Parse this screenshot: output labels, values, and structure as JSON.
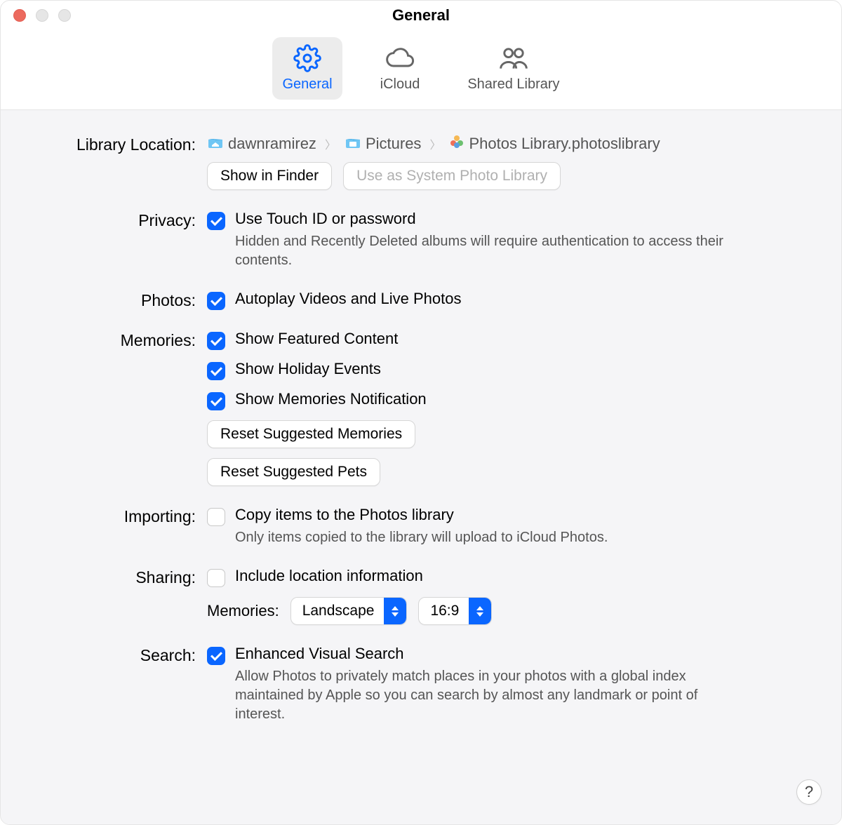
{
  "window": {
    "title": "General"
  },
  "toolbar": {
    "tabs": [
      {
        "label": "General"
      },
      {
        "label": "iCloud"
      },
      {
        "label": "Shared Library"
      }
    ]
  },
  "library": {
    "label": "Library Location:",
    "path": {
      "home": "dawnramirez",
      "folder": "Pictures",
      "file": "Photos Library.photoslibrary"
    },
    "show_in_finder": "Show in Finder",
    "use_system": "Use as System Photo Library"
  },
  "privacy": {
    "label": "Privacy:",
    "check_label": "Use Touch ID or password",
    "desc": "Hidden and Recently Deleted albums will require authentication to access their contents."
  },
  "photos": {
    "label": "Photos:",
    "check_label": "Autoplay Videos and Live Photos"
  },
  "memories": {
    "label": "Memories:",
    "c1": "Show Featured Content",
    "c2": "Show Holiday Events",
    "c3": "Show Memories Notification",
    "reset_mem": "Reset Suggested Memories",
    "reset_pets": "Reset Suggested Pets"
  },
  "importing": {
    "label": "Importing:",
    "check_label": "Copy items to the Photos library",
    "desc": "Only items copied to the library will upload to iCloud Photos."
  },
  "sharing": {
    "label": "Sharing:",
    "check_label": "Include location information",
    "mem_label": "Memories:",
    "orientation": "Landscape",
    "aspect": "16:9"
  },
  "search": {
    "label": "Search:",
    "check_label": "Enhanced Visual Search",
    "desc": "Allow Photos to privately match places in your photos with a global index maintained by Apple so you can search by almost any landmark or point of interest."
  },
  "help": "?"
}
